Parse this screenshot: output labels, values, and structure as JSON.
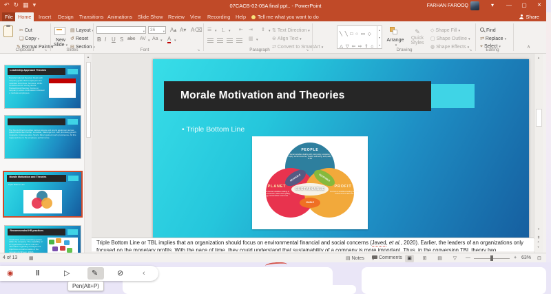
{
  "colors": {
    "titlebar": "#c04a28",
    "slide_gradient_start": "#38dee8",
    "slide_gradient_end": "#155a9c",
    "banner": "#262626",
    "accent_cyan": "#3fd4e6",
    "venn_people": "#2e7f9e",
    "venn_planet": "#e8334e",
    "venn_profit": "#f2a93b",
    "venn_bearable": "#565a82",
    "venn_equitable": "#86b93c",
    "venn_viable": "#ef7023",
    "selection_border": "#d04a2a"
  },
  "icons": {
    "undo": "↶",
    "redo": "↻",
    "slideshow_start": "▦",
    "qat_more": "▾",
    "minimize": "—",
    "maximize": "▢",
    "close": "×",
    "ribbon_options": "▾",
    "cut": "✂",
    "dropdown": "▾",
    "layout": "▤",
    "reset": "↺",
    "section": "⊟",
    "grow_font": "A▴",
    "shrink_font": "A▾",
    "clear_format": "A⌫",
    "bullets": "☰",
    "numbering": "⒈",
    "indent_less": "⇤",
    "indent_more": "⇥",
    "line_spacing": "⇕",
    "columns": "▥",
    "text_direction": "⇅",
    "align_text": "⊜",
    "smartart": "⇄",
    "replace": "⇄",
    "select": "⌖",
    "launcher": "↘",
    "collapse_ribbon": "∧",
    "scroll_up": "▲",
    "scroll_down": "▼",
    "prev_slide": "⇞",
    "next_slide": "⇟",
    "notes": "▤",
    "view_normal": "▣",
    "view_sorter": "⊞",
    "view_reading": "▤",
    "view_slideshow": "▽",
    "zoom_out": "—",
    "zoom_in": "+",
    "fit_window": "⊡",
    "status_display": "▦",
    "record": "◉",
    "pause": "‖",
    "pointer": "▷",
    "pen": "✎",
    "eraser": "⊘",
    "collapse_left": "‹"
  },
  "titlebar": {
    "title": "07CACB-02-05A final ppt.. - PowerPoint",
    "user": "FARHAN FAROOQ"
  },
  "tabs": {
    "file": "File",
    "home": "Home",
    "insert": "Insert",
    "design": "Design",
    "transitions": "Transitions",
    "animations": "Animations",
    "slideshow": "Slide Show",
    "review": "Review",
    "view": "View",
    "recording": "Recording",
    "help": "Help",
    "tellme": "Tell me what you want to do",
    "share": "Share"
  },
  "ribbon": {
    "clipboard": {
      "label": "Clipboard",
      "cut": "Cut",
      "copy": "Copy",
      "painter": "Format Painter"
    },
    "slides": {
      "label": "Slides",
      "new1": "New",
      "new2": "Slide",
      "layout": "Layout",
      "reset": "Reset",
      "section": "Section"
    },
    "font": {
      "label": "Font",
      "size": "36",
      "b": "B",
      "i": "I",
      "u": "U",
      "s": "S",
      "abc": "abc",
      "av": "AV",
      "aa": "Aa",
      "a": "A"
    },
    "paragraph": {
      "label": "Paragraph",
      "text_direction": "Text Direction",
      "align_text": "Align Text",
      "smartart": "Convert to SmartArt"
    },
    "drawing": {
      "label": "Drawing",
      "arrange": "Arrange",
      "quick1": "Quick",
      "quick2": "Styles",
      "fill": "Shape Fill",
      "outline": "Shape Outline",
      "effects": "Shape Effects",
      "shape_rows": [
        "╲ ╲ □ ○ ▭ ◇",
        "△ ▽ ⇦ ⇨ ⇧ ⌂",
        "☆ ⌒ { } ∿ ◇"
      ]
    },
    "editing": {
      "label": "Editing",
      "find": "Find",
      "replace": "Replace",
      "select": "Select"
    }
  },
  "thumbnails": [
    {
      "title": "Leadership Approach Theories",
      "body": "Transformational theories: Deals with company goals. Best employees are rewarded incentives, bonuses, shifts. Punishments for wrong deeds. Transactional theories: Focus on company's vision. Enthusiasm followed to motivate employees."
    },
    {
      "title": "",
      "body": "The Sports Direct provides various leisure and sports equipment across global brands like Dunlop, Lonsdale, Slazenger etc. with promising growth prospects. In Europe also, Sports Direct gained much prominence. All this happened due to the employee performance."
    },
    {
      "title": "Morale Motivation and Theories",
      "body": "Triple Bottom Line"
    },
    {
      "title": "Recommended HR practices",
      "body": "Introduction of the rewarding system within the company. The capability of an organization is about relevant information regarding management objectives as well as tasks of the company (in Bryson, 2018)."
    }
  ],
  "slide": {
    "title": "Morale Motivation and Theories",
    "bullet": "Triple Bottom Line",
    "venn": {
      "people": {
        "label": "PEOPLE",
        "desc": "Social variables dealing with community, education, equity, social resources, health, well-being, and quality of life"
      },
      "planet": {
        "label": "PLANET",
        "desc": "Environmental variables relating to natural resources, water & air quality, energy conservation & land use"
      },
      "profit": {
        "label": "PROFIT",
        "desc": "Economic variables dealing with the bottom line & cash flow"
      },
      "bearable": "BEARABLE",
      "equitable": "EQUITABLE",
      "viable": "VIABLE",
      "sustainable": "SUSTAINABLE"
    }
  },
  "notes": {
    "l1a": "Triple Bottom Line or TBL implies that an organization should focus on environmental financial and social concerns (",
    "link": "Javed",
    "l1b": ", ",
    "etal": "et al.",
    "l1c": ", 2020). Earlier, the leaders of an organizations",
    "l2": "only focused on the monetary profits. With the pace of time, they could understand that sustainability of a company is more important. Thus, in the conversion TBL theory two"
  },
  "statusbar": {
    "slide_no": "4 of 13",
    "notes": "Notes",
    "comments": "Comments",
    "zoom": "63%"
  },
  "overlay": {
    "tooltip": "Pen(Alt+P)"
  }
}
